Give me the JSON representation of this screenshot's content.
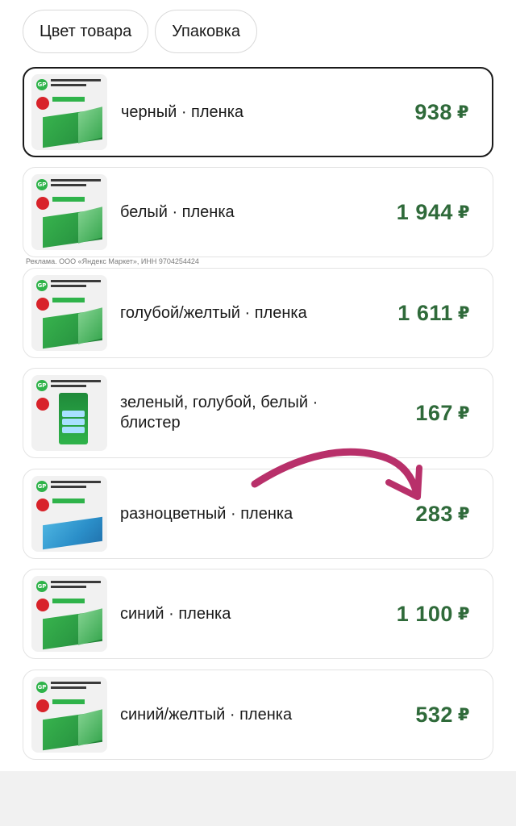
{
  "filters": [
    {
      "label": "Цвет товара"
    },
    {
      "label": "Упаковка"
    }
  ],
  "ad_note": "Реклама. ООО «Яндекс Маркет», ИНН 9704254424",
  "currency_symbol": "₽",
  "variants": [
    {
      "label": "черный · пленка",
      "price": "938",
      "selected": true,
      "image": "battery-box-30-icon"
    },
    {
      "label": "белый · пленка",
      "price": "1 944",
      "selected": false,
      "image": "battery-box-80-icon"
    },
    {
      "label": "голубой/желтый · пленка",
      "price": "1 611",
      "selected": false,
      "image": "battery-box-60-icon"
    },
    {
      "label": "зеленый, голубой, белый · блистер",
      "price": "167",
      "selected": false,
      "image": "battery-blister-4-icon"
    },
    {
      "label": "разноцветный · пленка",
      "price": "283",
      "selected": false,
      "image": "battery-box-10-icon"
    },
    {
      "label": "синий · пленка",
      "price": "1 100",
      "selected": false,
      "image": "battery-box-40-icon"
    },
    {
      "label": "синий/желтый · пленка",
      "price": "532",
      "selected": false,
      "image": "battery-box-20-icon"
    }
  ],
  "colors": {
    "price": "#2f6a3a",
    "selected_border": "#1a1a1a",
    "arrow": "#b8306a",
    "brand_green": "#2fb34a"
  }
}
